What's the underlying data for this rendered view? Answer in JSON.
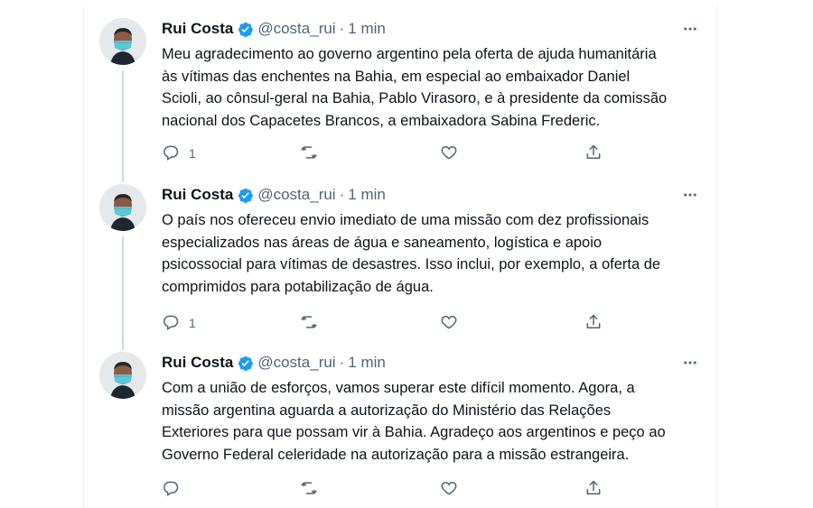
{
  "author": {
    "name": "Rui Costa",
    "handle": "@costa_rui",
    "separator": "·",
    "verified_color": "#1d9bf0"
  },
  "tweets": [
    {
      "time": "1 min",
      "text": "Meu agradecimento ao governo argentino pela oferta de ajuda humanitária\nàs vítimas das enchentes na Bahia, em especial ao embaixador Daniel\nScioli, ao cônsul-geral na Bahia, Pablo Virasoro, e à presidente da comissão\nnacional dos Capacetes Brancos, a embaixadora Sabina Frederic.",
      "reply_count": "1"
    },
    {
      "time": "1 min",
      "text": "O país nos ofereceu envio imediato de uma missão com dez profissionais\nespecializados nas áreas de água e saneamento, logística e apoio\npsicossocial para vítimas de desastres. Isso inclui, por exemplo, a oferta de\ncomprimidos para potabilização de água.",
      "reply_count": "1"
    },
    {
      "time": "1 min",
      "text": "Com a união de esforços, vamos superar este difícil momento. Agora, a\nmissão argentina aguarda a autorização do Ministério das Relações\nExteriores para que possam vir à Bahia. Agradeço aos argentinos e peço ao\nGoverno Federal celeridade na autorização para a missão estrangeira.",
      "reply_count": ""
    }
  ],
  "icons": {
    "more": "more-icon",
    "reply": "reply-icon",
    "retweet": "retweet-icon",
    "like": "like-icon",
    "share": "share-icon",
    "verified": "verified-badge-icon"
  },
  "colors": {
    "text": "#0f1419",
    "secondary": "#536471",
    "thread_line": "#cfd9de",
    "mask": "#5cc7d6"
  }
}
